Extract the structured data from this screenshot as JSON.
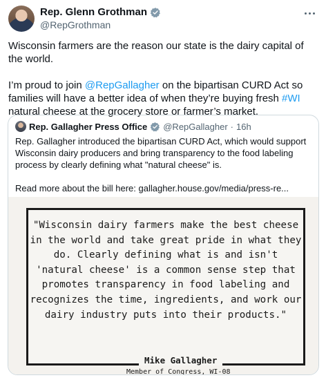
{
  "tweet": {
    "author": {
      "display_name": "Rep. Glenn Grothman",
      "handle": "@RepGrothman",
      "verified_icon": "verified-badge-icon"
    },
    "more_icon": "more-horizontal-icon",
    "paragraph1": "Wisconsin farmers are the reason our state is the dairy capital of the world.",
    "paragraph2": {
      "part1": "I’m proud to join ",
      "mention": "@RepGallagher",
      "part2": " on the bipartisan CURD Act so families will have a better idea of when they’re buying fresh ",
      "hashtag": "#WI",
      "part3": " natural cheese at the grocery store or farmer’s market."
    }
  },
  "quoted_tweet": {
    "display_name": "Rep. Gallagher Press Office",
    "handle": "@RepGallagher",
    "separator": "·",
    "time": "16h",
    "text": "Rep. Gallagher introduced the bipartisan CURD Act, which would support Wisconsin dairy producers and bring transparency to the food labeling process by clearly defining what \"natural cheese\" is.",
    "read_more": "Read more about the bill here: gallagher.house.gov/media/press-re...",
    "image": {
      "quote": "\"Wisconsin dairy farmers make the best cheese in the world and take great pride in what they do. Clearly defining what is and isn't 'natural cheese' is a common sense step that promotes transparency in food labeling and recognizes the time, ingredients, and work our dairy industry puts into their products.\"",
      "signature_name": "Mike Gallagher",
      "signature_title": "Member of Congress, WI-08"
    }
  },
  "colors": {
    "accent": "#1d9bf0",
    "text": "#0f1419",
    "muted": "#536471",
    "border": "#cfd9de"
  }
}
